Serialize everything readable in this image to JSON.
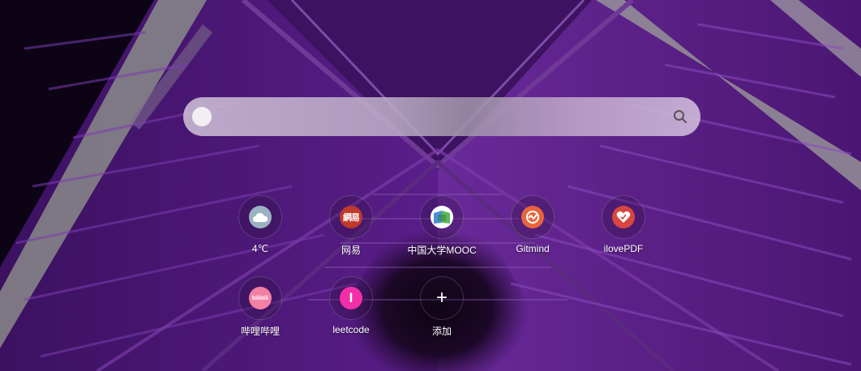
{
  "search": {
    "placeholder": "",
    "value": ""
  },
  "shortcuts": [
    {
      "label": "4℃",
      "icon": "weather-cloud-icon",
      "color": "#9db2c1"
    },
    {
      "label": "网易",
      "icon": "netease-logo-icon",
      "icon_text": "網易",
      "color": "#c0392b"
    },
    {
      "label": "中国大学MOOC",
      "icon": "mooc-book-icon",
      "color": "#ffffff"
    },
    {
      "label": "Gitmind",
      "icon": "gitmind-logo-icon",
      "color": "#e8643c"
    },
    {
      "label": "ilovePDF",
      "icon": "ilovepdf-heart-icon",
      "color": "#d8463f"
    },
    {
      "label": "哔哩哔哩",
      "icon": "bilibili-logo-icon",
      "icon_text": "bilibili",
      "color": "#f27fa4"
    },
    {
      "label": "leetcode",
      "icon": "leetcode-logo-icon",
      "icon_text": "I",
      "color": "#f22fa8"
    },
    {
      "label": "添加",
      "icon": "plus-icon",
      "icon_text": "+"
    }
  ]
}
